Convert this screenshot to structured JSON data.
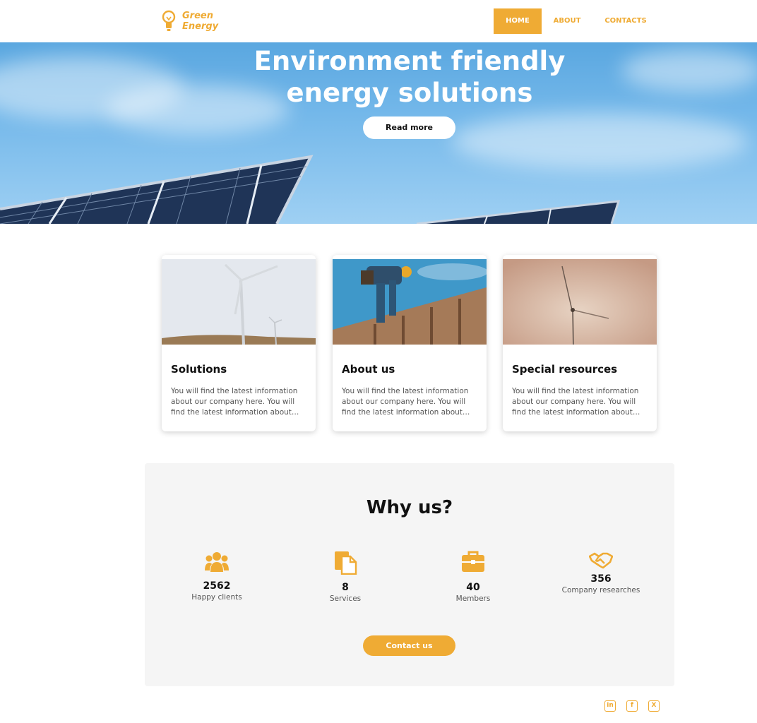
{
  "brand": {
    "line1": "Green",
    "line2": "Energy",
    "accent": "#efab34"
  },
  "nav": {
    "items": [
      {
        "label": "HOME"
      },
      {
        "label": "ABOUT"
      },
      {
        "label": "CONTACTS"
      }
    ]
  },
  "hero": {
    "title": "Environment friendly energy solutions",
    "button": "Read more"
  },
  "cards": [
    {
      "title": "Solutions",
      "text": "You will find the latest information about our company here. You will find the latest information about…"
    },
    {
      "title": "About us",
      "text": "You will find the latest information about our company here. You will find the latest information about…"
    },
    {
      "title": "Special resources",
      "text": "You will find the latest information about our company here. You will find the latest information about…"
    }
  ],
  "why": {
    "title": "Why us?",
    "stats": [
      {
        "icon": "users-icon",
        "value": "2562",
        "label": "Happy clients"
      },
      {
        "icon": "document-icon",
        "value": "8",
        "label": "Services"
      },
      {
        "icon": "briefcase-icon",
        "value": "40",
        "label": "Members"
      },
      {
        "icon": "handshake-icon",
        "value": "356",
        "label": "Company researches"
      }
    ],
    "button": "Contact us"
  },
  "social": [
    {
      "icon": "linkedin-icon",
      "glyph": "in"
    },
    {
      "icon": "facebook-icon",
      "glyph": "f"
    },
    {
      "icon": "x-icon",
      "glyph": "X"
    }
  ]
}
